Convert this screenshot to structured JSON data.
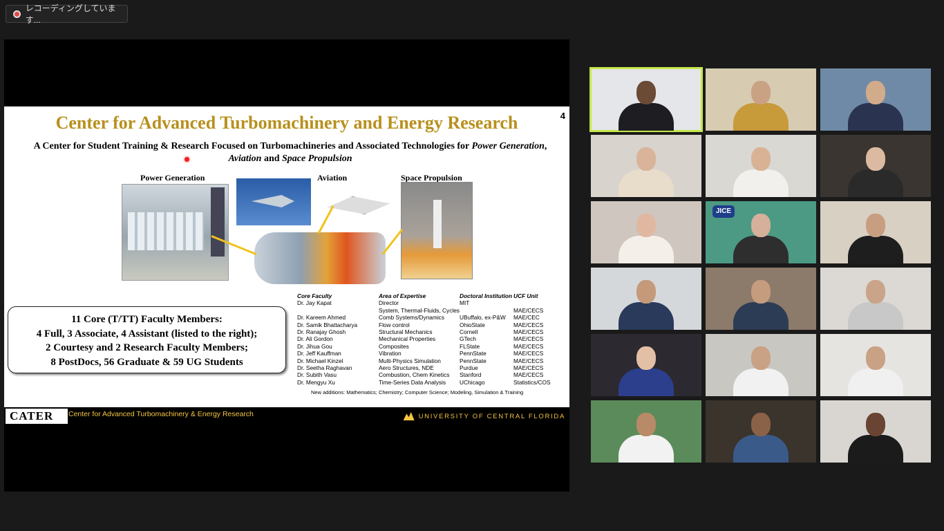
{
  "recording": {
    "label": "レコーディングしています..."
  },
  "slide": {
    "number": "4",
    "title": "Center for Advanced Turbomachinery and Energy Research",
    "subtitle_part1": "A Center for Student Training & Research Focused on Turbomachineries and Associated Technologies for ",
    "subtitle_italic1": "Power Generation",
    "subtitle_comma": ", ",
    "subtitle_italic2": "Aviation",
    "subtitle_and": " and ",
    "subtitle_italic3": "Space Propulsion",
    "labels": {
      "power": "Power Generation",
      "aviation": "Aviation",
      "space": "Space Propulsion"
    },
    "faculty_summary": [
      "11 Core (T/TT) Faculty Members:",
      "4 Full, 3 Associate, 4 Assistant (listed to the right);",
      "2 Courtesy and 2 Research Faculty Members;",
      "8 PostDocs, 56 Graduate & 59 UG Students"
    ],
    "table": {
      "headers": [
        "Core Faculty",
        "Area of Expertise",
        "Doctoral Institution",
        "UCF Unit"
      ],
      "rows": [
        [
          "Dr. Jay Kapat",
          "Director",
          "MIT",
          ""
        ],
        [
          "",
          "System, Thermal-Fluids, Cycles",
          "",
          "MAE/CECS"
        ],
        [
          "Dr. Kareem Ahmed",
          "Comb Systems/Dynamics",
          "UBuffalo, ex-P&W",
          "MAE/CEC"
        ],
        [
          "Dr. Samik Bhattacharya",
          "Flow control",
          "OhioState",
          "MAE/CECS"
        ],
        [
          "Dr. Ranajay Ghosh",
          "Structural Mechanics",
          "Cornell",
          "MAE/CECS"
        ],
        [
          "Dr. Ali Gordon",
          "Mechanical Properties",
          "GTech",
          "MAE/CECS"
        ],
        [
          "Dr. Jihua Gou",
          "Composites",
          "FLState",
          "MAE/CECS"
        ],
        [
          "Dr. Jeff Kauffman",
          "Vibration",
          "PennState",
          "MAE/CECS"
        ],
        [
          "Dr. Michael Kinzel",
          "Multi-Physics Simulation",
          "PennState",
          "MAE/CECS"
        ],
        [
          "Dr. Seetha Raghavan",
          "Aero Structures, NDE",
          "Purdue",
          "MAE/CECS"
        ],
        [
          "Dr. Subith Vasu",
          "Combustion, Chem Kinetics",
          "Stanford",
          "MAE/CECS"
        ],
        [
          "Dr. Mengyu Xu",
          "Time-Series Data Analysis",
          "UChicago",
          "Statistics/COS"
        ]
      ]
    },
    "note": "New additions: Mathematics; Chemistry; Computer Science; Modeling, Simulation & Training",
    "footer": {
      "logo": "CATER",
      "center_name": "Center for Advanced Turbomachinery & Energy Research",
      "university": "UNIVERSITY OF CENTRAL FLORIDA"
    }
  },
  "gallery": {
    "jice_logo": "JICE",
    "tiles": [
      {
        "name": "participant-1",
        "bg": "#e4e6ea",
        "skin": "#6b4a36",
        "shirt": "#1d1d22",
        "active": true
      },
      {
        "name": "participant-2",
        "bg": "#d7cbb2",
        "skin": "#c9a283",
        "shirt": "#c79a3a"
      },
      {
        "name": "participant-3",
        "bg": "#6f8aa6",
        "skin": "#d2ab8a",
        "shirt": "#2a3450"
      },
      {
        "name": "participant-4",
        "bg": "#d8d4cd",
        "skin": "#d9b49a",
        "shirt": "#e8dccb"
      },
      {
        "name": "participant-5",
        "bg": "#d9d8d3",
        "skin": "#d9b296",
        "shirt": "#f1f0ec"
      },
      {
        "name": "participant-6",
        "bg": "#3a3530",
        "skin": "#dcbaa2",
        "shirt": "#2a2a2a"
      },
      {
        "name": "participant-7",
        "bg": "#cfc6bf",
        "skin": "#e0b8a2",
        "shirt": "#f4efe9"
      },
      {
        "name": "participant-8",
        "bg": "#4c9a84",
        "skin": "#d6b09a",
        "shirt": "#2e2e2e"
      },
      {
        "name": "participant-9",
        "bg": "#d8d0c2",
        "skin": "#c79e80",
        "shirt": "#1e1e1e"
      },
      {
        "name": "participant-10",
        "bg": "#d5d8da",
        "skin": "#c49a7b",
        "shirt": "#2a3a5a"
      },
      {
        "name": "participant-11",
        "bg": "#8c7a6a",
        "skin": "#c69c7e",
        "shirt": "#2c3c55"
      },
      {
        "name": "participant-12",
        "bg": "#dcd9d4",
        "skin": "#c9a488",
        "shirt": "#c8c8c8"
      },
      {
        "name": "participant-13",
        "bg": "#2c2a30",
        "skin": "#e2bfa5",
        "shirt": "#2c3f8c"
      },
      {
        "name": "participant-14",
        "bg": "#c9c7c2",
        "skin": "#c9a184",
        "shirt": "#f1f1f1"
      },
      {
        "name": "participant-15",
        "bg": "#e6e4e0",
        "skin": "#c9a184",
        "shirt": "#f0f0f0"
      },
      {
        "name": "participant-16",
        "bg": "#5b8b5a",
        "skin": "#b88a68",
        "shirt": "#f2f2f2"
      },
      {
        "name": "participant-17",
        "bg": "#3a342c",
        "skin": "#8a6248",
        "shirt": "#3a5a8a"
      },
      {
        "name": "participant-18",
        "bg": "#d9d6d1",
        "skin": "#6a4432",
        "shirt": "#1b1b1b"
      }
    ]
  }
}
